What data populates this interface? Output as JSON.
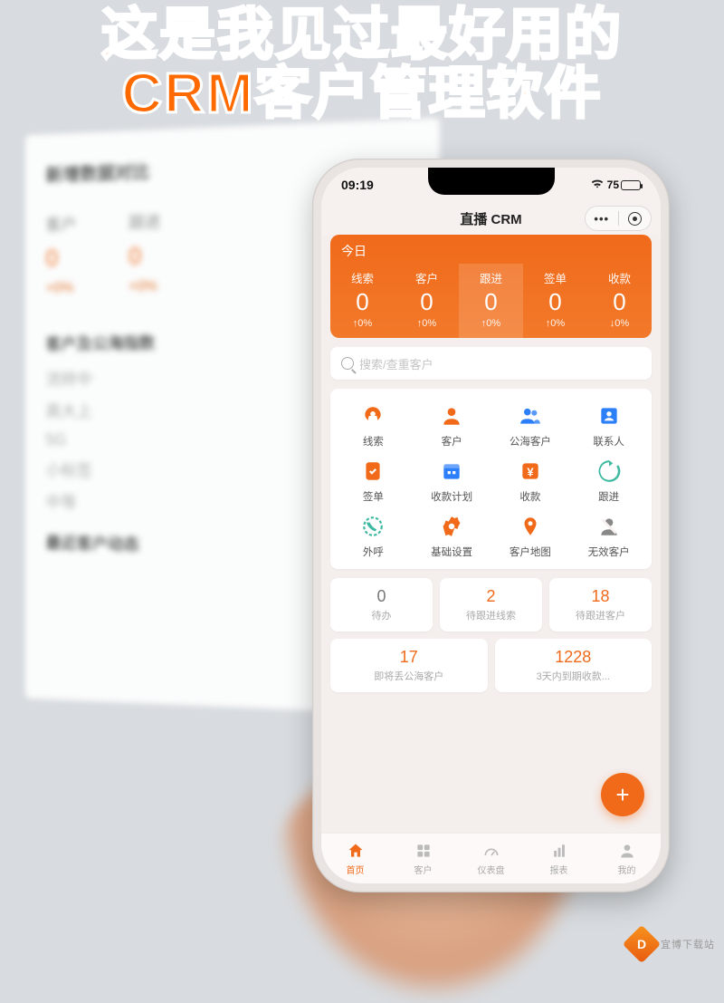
{
  "overlay": {
    "headline_l1": "这是我见过最好用的",
    "headline_l2": "CRM客户管理软件"
  },
  "background_monitor": {
    "section1_title": "新增数据对比",
    "columns": [
      {
        "label": "客户",
        "value": "0",
        "pct": "+0%"
      },
      {
        "label": "跟进",
        "value": "0",
        "pct": "+0%"
      }
    ],
    "section2_title": "客户及公海指数",
    "rows": [
      "流转中",
      "高大上",
      "5G",
      "小标签",
      "中等"
    ],
    "section3_title": "最近客户动态"
  },
  "statusbar": {
    "time": "09:19",
    "battery": "75"
  },
  "header": {
    "title": "直播 CRM",
    "menu_dots": "•••"
  },
  "today_card": {
    "title": "今日",
    "stats": [
      {
        "label": "线索",
        "value": "0",
        "pct": "↑0%"
      },
      {
        "label": "客户",
        "value": "0",
        "pct": "↑0%"
      },
      {
        "label": "跟进",
        "value": "0",
        "pct": "↑0%",
        "selected": true
      },
      {
        "label": "签单",
        "value": "0",
        "pct": "↑0%"
      },
      {
        "label": "收款",
        "value": "0",
        "pct": "↓0%"
      }
    ]
  },
  "search": {
    "placeholder": "搜索/查重客户"
  },
  "nav_grid": [
    [
      {
        "icon": "lead-icon",
        "label": "线索",
        "color": "#f06a1a"
      },
      {
        "icon": "customer-icon",
        "label": "客户",
        "color": "#f06a1a"
      },
      {
        "icon": "public-customer-icon",
        "label": "公海客户",
        "color": "#2d7ff9"
      },
      {
        "icon": "contact-icon",
        "label": "联系人",
        "color": "#2d7ff9"
      }
    ],
    [
      {
        "icon": "contract-icon",
        "label": "签单",
        "color": "#f06a1a"
      },
      {
        "icon": "payment-plan-icon",
        "label": "收款计划",
        "color": "#2d7ff9"
      },
      {
        "icon": "payment-icon",
        "label": "收款",
        "color": "#f06a1a"
      },
      {
        "icon": "followup-icon",
        "label": "跟进",
        "color": "#3fb9a1"
      }
    ],
    [
      {
        "icon": "callout-icon",
        "label": "外呼",
        "color": "#3fb9a1"
      },
      {
        "icon": "settings-icon",
        "label": "基础设置",
        "color": "#f06a1a"
      },
      {
        "icon": "map-icon",
        "label": "客户地图",
        "color": "#f06a1a"
      },
      {
        "icon": "invalid-icon",
        "label": "无效客户",
        "color": "#888"
      }
    ]
  ],
  "tiles": [
    {
      "value": "0",
      "orange": false,
      "label": "待办"
    },
    {
      "value": "2",
      "orange": true,
      "label": "待跟进线索"
    },
    {
      "value": "18",
      "orange": true,
      "label": "待跟进客户"
    },
    {
      "value": "17",
      "orange": true,
      "label": "即将丢公海客户"
    },
    {
      "value": "1228",
      "orange": true,
      "label": "3天内到期收款..."
    }
  ],
  "fab": {
    "glyph": "+"
  },
  "tabbar": [
    {
      "id": "home",
      "label": "首页",
      "active": true
    },
    {
      "id": "customers",
      "label": "客户",
      "active": false
    },
    {
      "id": "dashboard",
      "label": "仪表盘",
      "active": false
    },
    {
      "id": "reports",
      "label": "报表",
      "active": false
    },
    {
      "id": "mine",
      "label": "我的",
      "active": false
    }
  ],
  "watermark": {
    "site": "宜博下载站"
  },
  "colors": {
    "accent": "#f06a1a",
    "blue": "#2d7ff9",
    "teal": "#3fb9a1"
  }
}
